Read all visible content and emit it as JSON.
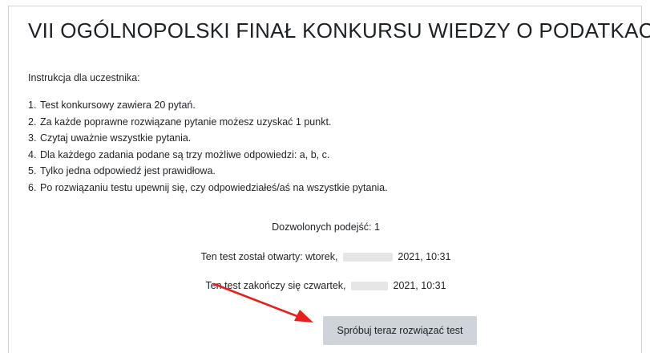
{
  "quiz": {
    "title": "VII OGÓLNOPOLSKI FINAŁ KONKURSU WIEDZY O PODATKACH",
    "intro": "Instrukcja dla uczestnika:",
    "rules": [
      {
        "num": "1.",
        "text": "Test konkursowy zawiera 20 pytań."
      },
      {
        "num": "2.",
        "text": "Za każde poprawne rozwiązane pytanie możesz uzyskać 1 punkt."
      },
      {
        "num": "3.",
        "text": "Czytaj uważnie wszystkie pytania."
      },
      {
        "num": "4.",
        "text": "Dla każdego zadania podane są trzy możliwe odpowiedzi: a, b, c."
      },
      {
        "num": "5.",
        "text": "Tylko jedna odpowiedź jest prawidłowa."
      },
      {
        "num": "6.",
        "text": "Po rozwiązaniu testu upewnij się, czy odpowiedziałeś/aś na wszystkie pytania."
      }
    ],
    "attempts_allowed": "Dozwolonych podejść: 1",
    "opened_prefix": "Ten test został otwarty: wtorek,",
    "opened_suffix": "2021, 10:31",
    "closes_prefix": "Ten test zakończy się czwartek,",
    "closes_suffix": "2021, 10:31",
    "attempt_button": "Spróbuj teraz rozwiązać test"
  },
  "colors": {
    "arrow": "#e8201c",
    "button_bg": "#ced4da",
    "border": "#cfd3d7",
    "text": "#1d2125"
  }
}
